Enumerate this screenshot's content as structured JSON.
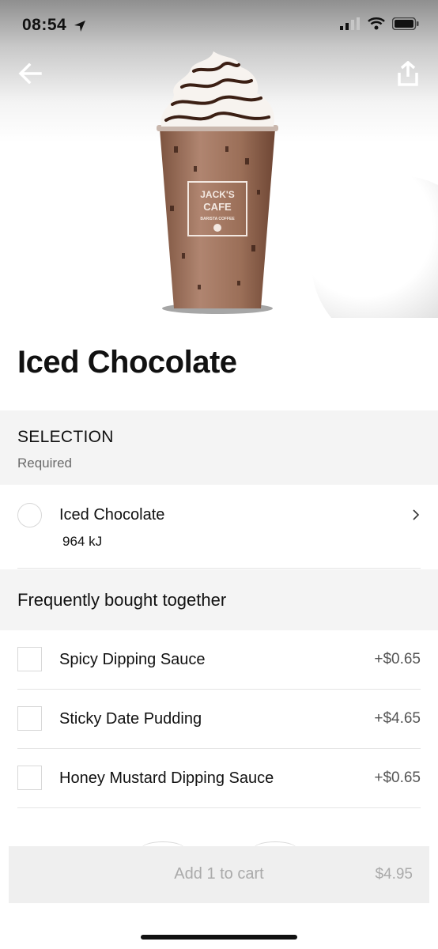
{
  "status_bar": {
    "time": "08:54",
    "icons": [
      "location-arrow-icon",
      "signal-icon",
      "wifi-icon",
      "battery-icon"
    ]
  },
  "hero": {
    "cup_logo_line1": "JACK'S",
    "cup_logo_line2": "CAFE",
    "cup_logo_line3": "BARISTA COFFEE"
  },
  "nav": {
    "back_icon": "arrow-left-icon",
    "share_icon": "share-icon"
  },
  "product": {
    "title": "Iced Chocolate"
  },
  "selection": {
    "title": "SELECTION",
    "subtitle": "Required",
    "option": {
      "label": "Iced Chocolate",
      "detail": "964 kJ"
    }
  },
  "frequently_bought": {
    "title": "Frequently bought together",
    "items": [
      {
        "label": "Spicy Dipping Sauce",
        "price": "+$0.65"
      },
      {
        "label": "Sticky Date Pudding",
        "price": "+$4.65"
      },
      {
        "label": "Honey Mustard Dipping Sauce",
        "price": "+$0.65"
      }
    ]
  },
  "cart": {
    "label": "Add 1 to cart",
    "price": "$4.95"
  },
  "colors": {
    "section_bg": "#f4f4f4",
    "divider": "#e5e5e5",
    "price_text": "#545454",
    "disabled_text": "#aaaaaa",
    "chocolate": "#9b6f55"
  }
}
